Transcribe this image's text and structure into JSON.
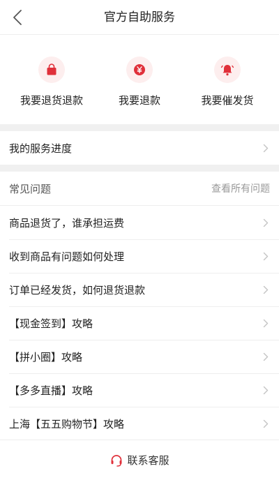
{
  "header": {
    "title": "官方自助服务",
    "back_icon": "chevron-left-icon"
  },
  "quick_actions": [
    {
      "label": "我要退货退款",
      "icon": "shopping-bag-icon",
      "icon_bg": "#fdeeee",
      "icon_color": "#e0303a"
    },
    {
      "label": "我要退款",
      "icon": "yen-coin-icon",
      "icon_bg": "#fdeeee",
      "icon_color": "#e0303a"
    },
    {
      "label": "我要催发货",
      "icon": "bell-icon",
      "icon_bg": "#fdeeee",
      "icon_color": "#e0303a"
    }
  ],
  "progress": {
    "label": "我的服务进度"
  },
  "faq": {
    "title": "常见问题",
    "view_all": "查看所有问题",
    "items": [
      "商品退货了，谁承担运费",
      "收到商品有问题如何处理",
      "订单已经发货，如何退货退款",
      "【现金签到】攻略",
      "【拼小圈】攻略",
      "【多多直播】攻略",
      "上海【五五购物节】攻略"
    ]
  },
  "contact": {
    "label": "联系客服",
    "icon": "headset-icon",
    "icon_color": "#e0303a"
  }
}
